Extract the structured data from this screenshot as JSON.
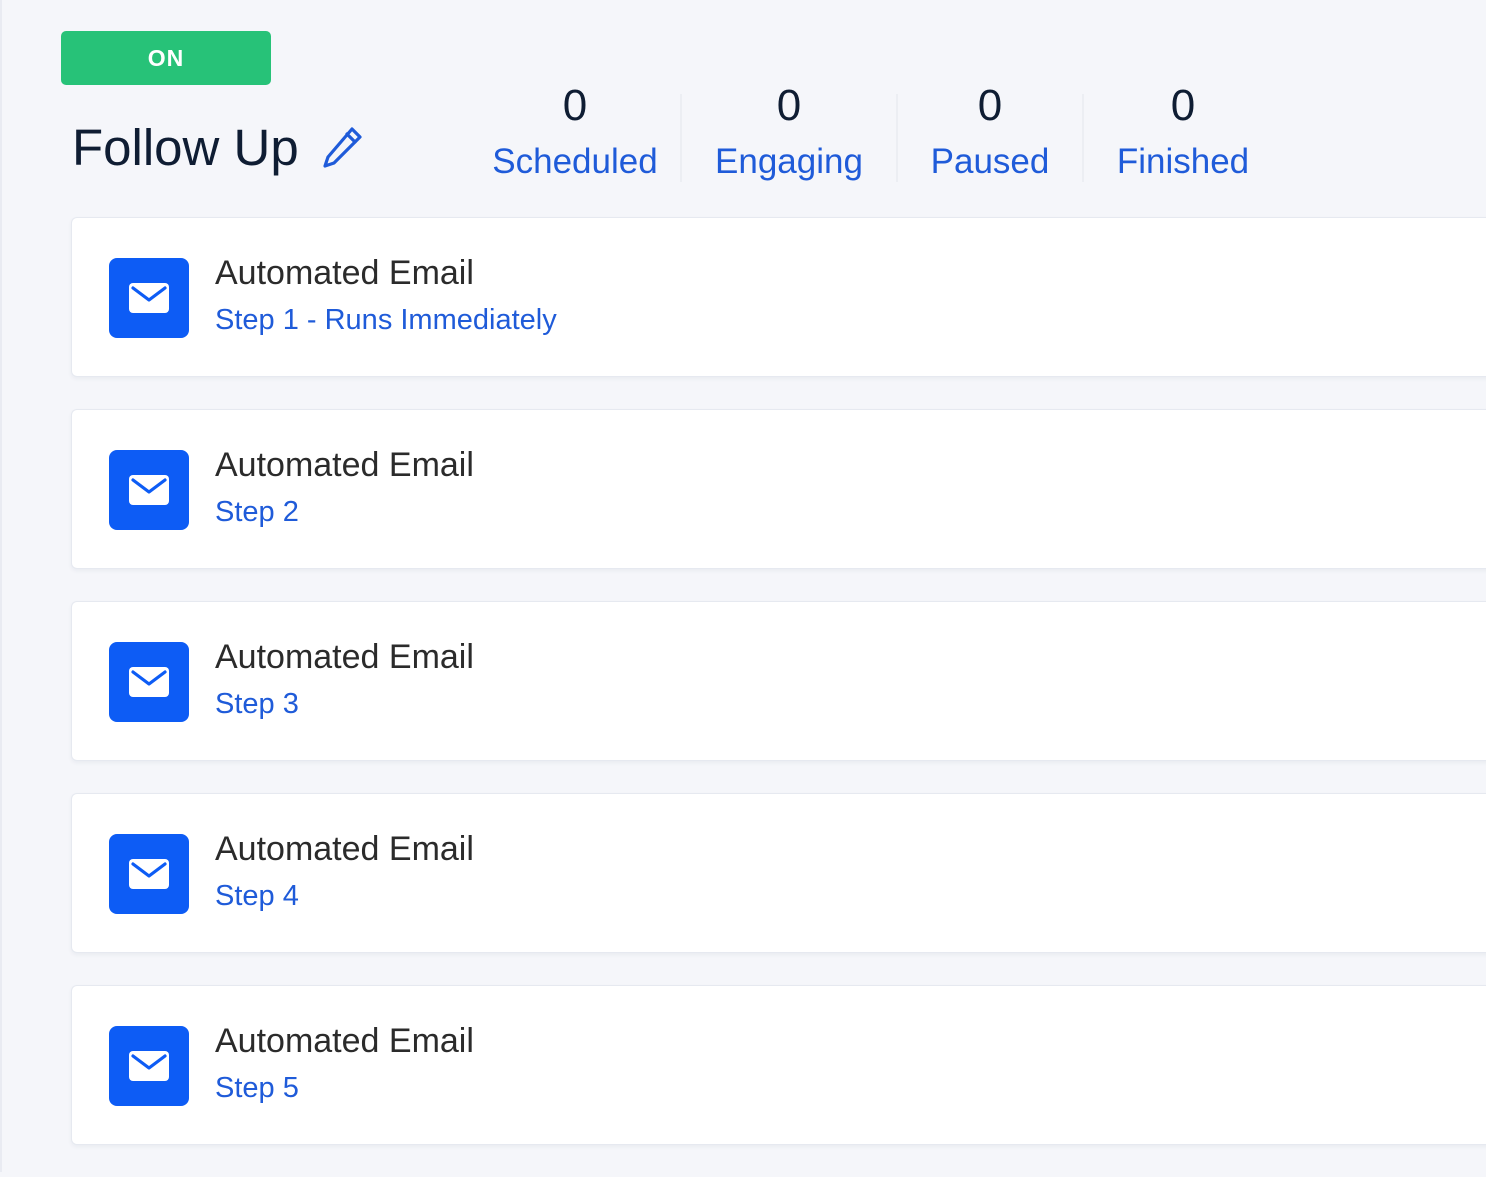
{
  "header": {
    "status_label": "ON",
    "title": "Follow Up"
  },
  "stats": [
    {
      "value": "0",
      "label": "Scheduled"
    },
    {
      "value": "0",
      "label": "Engaging"
    },
    {
      "value": "0",
      "label": "Paused"
    },
    {
      "value": "0",
      "label": "Finished"
    }
  ],
  "steps": [
    {
      "title": "Automated Email",
      "subtitle": "Step 1 - Runs Immediately",
      "icon": "mail-icon"
    },
    {
      "title": "Automated Email",
      "subtitle": "Step 2",
      "icon": "mail-icon"
    },
    {
      "title": "Automated Email",
      "subtitle": "Step 3",
      "icon": "mail-icon"
    },
    {
      "title": "Automated Email",
      "subtitle": "Step 4",
      "icon": "mail-icon"
    },
    {
      "title": "Automated Email",
      "subtitle": "Step 5",
      "icon": "mail-icon"
    }
  ],
  "colors": {
    "status_on": "#27c278",
    "accent_blue": "#1f5bd9",
    "icon_tile": "#0d5cf5",
    "background": "#f5f6fa"
  }
}
